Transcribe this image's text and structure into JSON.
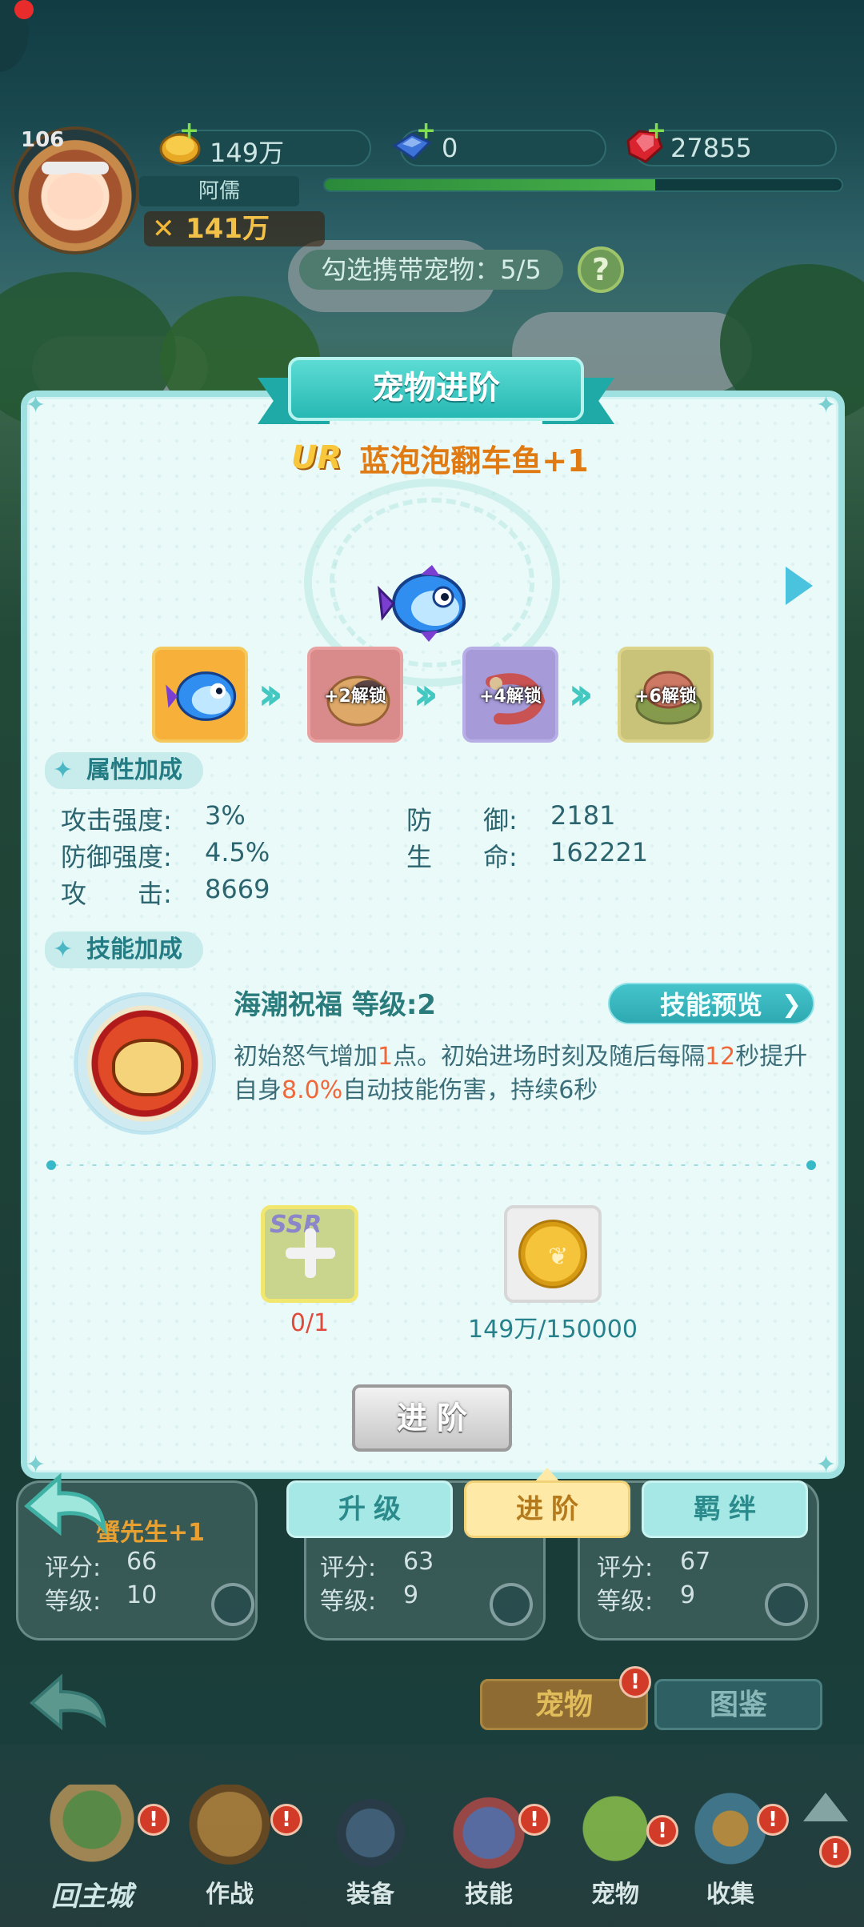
{
  "player": {
    "level": "106",
    "name": "阿儒",
    "power": "141万",
    "exp_progress": 0.64
  },
  "resources": [
    {
      "icon": "gold-coin-icon",
      "value": "149万"
    },
    {
      "icon": "blue-gem-icon",
      "value": "0"
    },
    {
      "icon": "red-ruby-icon",
      "value": "27855"
    }
  ],
  "carry": {
    "label": "勾选携带宠物：5/5",
    "help": "?"
  },
  "dialog": {
    "title": "宠物进阶",
    "rarity": "UR",
    "pet_name": "蓝泡泡翻车鱼+1",
    "evolution": [
      {
        "label": "",
        "color": "#f7b13a"
      },
      {
        "label": "+2解锁",
        "color": "#d98a8a"
      },
      {
        "label": "+4解锁",
        "color": "#a69ad9"
      },
      {
        "label": "+6解锁",
        "color": "#c9c37a"
      }
    ],
    "attr_section": "属性加成",
    "attributes_left": [
      {
        "label": "攻击强度:",
        "value": "3%"
      },
      {
        "label": "防御强度:",
        "value": "4.5%"
      },
      {
        "label": "攻　　击:",
        "value": "8669"
      }
    ],
    "attributes_right": [
      {
        "label": "防　　御:",
        "value": "2181"
      },
      {
        "label": "生　　命:",
        "value": "162221"
      }
    ],
    "skill_section": "技能加成",
    "skill_name": "海潮祝福  等级:2",
    "skill_preview": "技能预览",
    "skill_desc": {
      "p1": "初始怒气增加",
      "n1": "1",
      "p2": "点。初始进场时刻及随后每隔",
      "n2": "12",
      "p3": "秒提升自身",
      "n3": "8.0%",
      "p4": "自动技能伤害，持续6秒"
    },
    "materials": [
      {
        "tag": "SSR",
        "count": "0/1"
      },
      {
        "tag": "",
        "count": "149万/150000"
      }
    ],
    "advance_button": "进阶"
  },
  "sub_tabs": [
    {
      "label": "升级",
      "active": false
    },
    {
      "label": "进阶",
      "active": true
    },
    {
      "label": "羁绊",
      "active": false
    }
  ],
  "bg_cards": [
    {
      "title": "蟹先生+1",
      "score_label": "评分:",
      "score": "66",
      "level_label": "等级:",
      "level": "10"
    },
    {
      "title": "",
      "score_label": "评分:",
      "score": "63",
      "level_label": "等级:",
      "level": "9"
    },
    {
      "title": "",
      "score_label": "评分:",
      "score": "67",
      "level_label": "等级:",
      "level": "9"
    }
  ],
  "main_tabs": [
    {
      "label": "宠物",
      "badge": "!"
    },
    {
      "label": "图鉴",
      "badge": ""
    }
  ],
  "bottom_nav": [
    {
      "label": "回主城",
      "icon": "castle-icon",
      "badge": "!"
    },
    {
      "label": "作战",
      "icon": "battle-icon",
      "badge": "!"
    },
    {
      "label": "装备",
      "icon": "cannon-icon",
      "badge": ""
    },
    {
      "label": "技能",
      "icon": "spellbook-icon",
      "badge": "!"
    },
    {
      "label": "宠物",
      "icon": "pet-icon",
      "badge": "!"
    },
    {
      "label": "收集",
      "icon": "collection-icon",
      "badge": "!"
    }
  ],
  "colors": {
    "accent": "#27b8b3",
    "highlight": "#f0683a",
    "name_orange": "#e07a12"
  }
}
